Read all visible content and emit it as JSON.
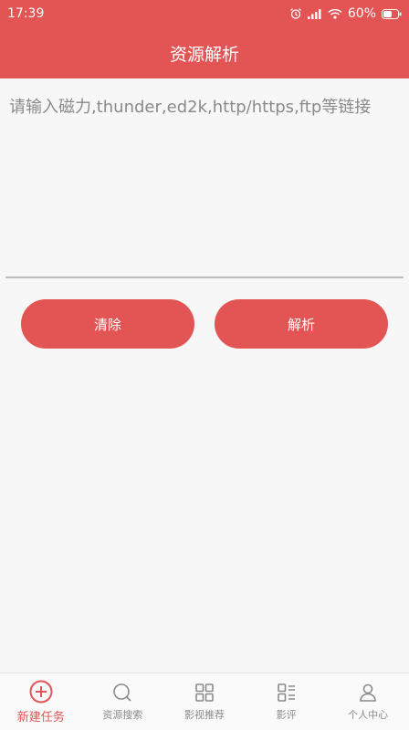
{
  "status_bar": {
    "time": "17:39",
    "battery": "60%"
  },
  "header": {
    "title": "资源解析"
  },
  "input": {
    "placeholder": "请输入磁力,thunder,ed2k,http/https,ftp等链接",
    "value": ""
  },
  "buttons": {
    "clear_label": "清除",
    "parse_label": "解析"
  },
  "tabs": [
    {
      "label": "新建任务",
      "icon": "plus-circle-icon",
      "active": true
    },
    {
      "label": "资源搜索",
      "icon": "search-icon",
      "active": false
    },
    {
      "label": "影视推荐",
      "icon": "grid-icon",
      "active": false
    },
    {
      "label": "影评",
      "icon": "list-grid-icon",
      "active": false
    },
    {
      "label": "个人中心",
      "icon": "person-icon",
      "active": false
    }
  ],
  "colors": {
    "accent": "#e35454",
    "tab_inactive": "#8a8a8a"
  }
}
